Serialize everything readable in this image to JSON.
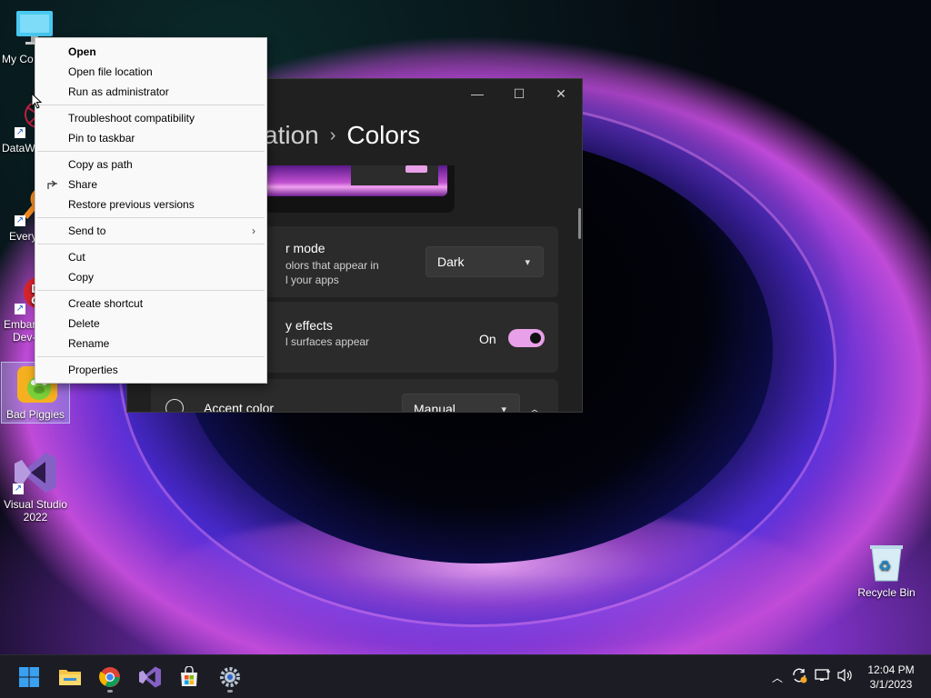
{
  "desktop": {
    "icons": [
      {
        "label": "My Co"
      },
      {
        "label": "DataW"
      },
      {
        "label": "Every"
      },
      {
        "label": "Embar",
        "label2": "Dev-"
      },
      {
        "label": "Bad Piggies"
      },
      {
        "label": "Visual Studio",
        "label2": "2022"
      },
      {
        "label": "Recycle Bin"
      }
    ]
  },
  "settings": {
    "breadcrumb_parent": "ation",
    "breadcrumb_separator": "›",
    "breadcrumb_current": "Colors",
    "app_mode": {
      "title": "r mode",
      "desc1": "olors that appear in",
      "desc2": "l your apps",
      "value": "Dark"
    },
    "transparency": {
      "title": "y effects",
      "desc": "l surfaces appear",
      "state": "On"
    },
    "accent": {
      "title": "Accent color",
      "value": "Manual"
    }
  },
  "context_menu": {
    "items": [
      {
        "label": "Open"
      },
      {
        "label": "Open file location"
      },
      {
        "label": "Run as administrator"
      },
      {
        "label": "Troubleshoot compatibility"
      },
      {
        "label": "Pin to taskbar"
      },
      {
        "label": "Copy as path"
      },
      {
        "label": "Share"
      },
      {
        "label": "Restore previous versions"
      },
      {
        "label": "Send to"
      },
      {
        "label": "Cut"
      },
      {
        "label": "Copy"
      },
      {
        "label": "Create shortcut"
      },
      {
        "label": "Delete"
      },
      {
        "label": "Rename"
      },
      {
        "label": "Properties"
      }
    ]
  },
  "taskbar": {
    "time": "12:04 PM",
    "date": "3/1/2023"
  },
  "colors": {
    "accent": "#e8a0e8",
    "window_bg": "#202020",
    "card_bg": "#2b2b2b",
    "taskbar_bg": "#1c1c24"
  }
}
